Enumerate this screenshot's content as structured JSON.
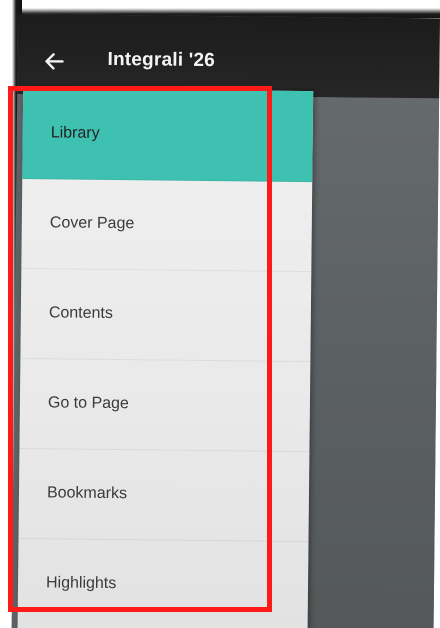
{
  "app_bar": {
    "title": "Integrali '26",
    "back_icon": "arrow-left-icon"
  },
  "drawer": {
    "items": [
      {
        "label": "Library",
        "active": true
      },
      {
        "label": "Cover Page",
        "active": false
      },
      {
        "label": "Contents",
        "active": false
      },
      {
        "label": "Go to Page",
        "active": false
      },
      {
        "label": "Bookmarks",
        "active": false
      },
      {
        "label": "Highlights",
        "active": false
      }
    ]
  },
  "colors": {
    "accent": "#3fc1b1",
    "app_bar": "#1c1c1c",
    "annotation": "#ff1a1a"
  }
}
